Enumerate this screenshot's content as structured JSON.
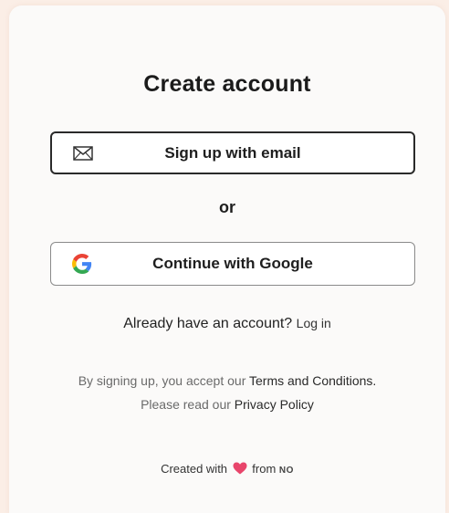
{
  "title": "Create account",
  "email_button": {
    "label": "Sign up with email",
    "icon": "envelope-icon"
  },
  "divider": "or",
  "google_button": {
    "label": "Continue with Google",
    "icon": "google-g-icon"
  },
  "login": {
    "prompt": "Already have an account?",
    "link": "Log in"
  },
  "terms": {
    "line1_prefix": "By signing up, you accept our",
    "terms_link": "Terms and Conditions.",
    "line2_prefix": "Please read our",
    "privacy_link": "Privacy Policy"
  },
  "footer": {
    "prefix": "Created with",
    "suffix": "from",
    "brand": "NO",
    "heart_color": "#e8456b"
  },
  "colors": {
    "background": "#fbeee6",
    "card": "#fbfaf9",
    "text": "#1e1e1e",
    "muted": "#6a6a6a"
  }
}
